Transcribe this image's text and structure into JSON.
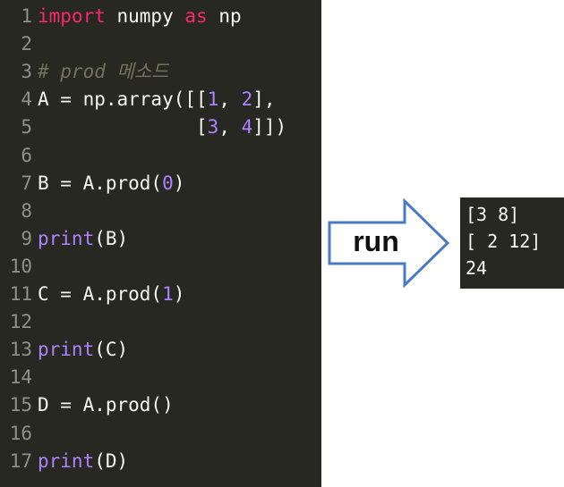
{
  "editor": {
    "lines": [
      {
        "n": "1",
        "parts": [
          {
            "t": "import",
            "c": "kw-import"
          },
          {
            "t": " numpy ",
            "c": ""
          },
          {
            "t": "as",
            "c": "kw-import"
          },
          {
            "t": " np",
            "c": ""
          }
        ]
      },
      {
        "n": "2",
        "parts": []
      },
      {
        "n": "3",
        "parts": [
          {
            "t": "# prod 메소드",
            "c": "comment"
          }
        ]
      },
      {
        "n": "4",
        "parts": [
          {
            "t": "A = np.array([[",
            "c": ""
          },
          {
            "t": "1",
            "c": "num"
          },
          {
            "t": ", ",
            "c": ""
          },
          {
            "t": "2",
            "c": "num"
          },
          {
            "t": "],",
            "c": ""
          }
        ]
      },
      {
        "n": "5",
        "parts": [
          {
            "t": "              [",
            "c": ""
          },
          {
            "t": "3",
            "c": "num"
          },
          {
            "t": ", ",
            "c": ""
          },
          {
            "t": "4",
            "c": "num"
          },
          {
            "t": "]])",
            "c": ""
          }
        ]
      },
      {
        "n": "6",
        "parts": []
      },
      {
        "n": "7",
        "parts": [
          {
            "t": "B = A.prod(",
            "c": ""
          },
          {
            "t": "0",
            "c": "num"
          },
          {
            "t": ")",
            "c": ""
          }
        ]
      },
      {
        "n": "8",
        "parts": []
      },
      {
        "n": "9",
        "parts": [
          {
            "t": "print",
            "c": "kw-print"
          },
          {
            "t": "(B)",
            "c": ""
          }
        ]
      },
      {
        "n": "10",
        "parts": []
      },
      {
        "n": "11",
        "parts": [
          {
            "t": "C = A.prod(",
            "c": ""
          },
          {
            "t": "1",
            "c": "num"
          },
          {
            "t": ")",
            "c": ""
          }
        ]
      },
      {
        "n": "12",
        "parts": []
      },
      {
        "n": "13",
        "parts": [
          {
            "t": "print",
            "c": "kw-print"
          },
          {
            "t": "(C)",
            "c": ""
          }
        ]
      },
      {
        "n": "14",
        "parts": []
      },
      {
        "n": "15",
        "parts": [
          {
            "t": "D = A.prod()",
            "c": ""
          }
        ]
      },
      {
        "n": "16",
        "parts": []
      },
      {
        "n": "17",
        "parts": [
          {
            "t": "print",
            "c": "kw-print"
          },
          {
            "t": "(D)",
            "c": ""
          }
        ]
      }
    ]
  },
  "arrow": {
    "label": "run",
    "stroke_color": "#4a7bc0",
    "fill_color": "#ffffff"
  },
  "output": {
    "lines": [
      "[3 8]",
      "[ 2 12]",
      "24"
    ]
  },
  "colors": {
    "editor_bg": "#272822",
    "keyword": "#f92672",
    "number": "#ae81ff",
    "comment": "#75715e",
    "text": "#f8f8f2",
    "gutter": "#90908a"
  }
}
